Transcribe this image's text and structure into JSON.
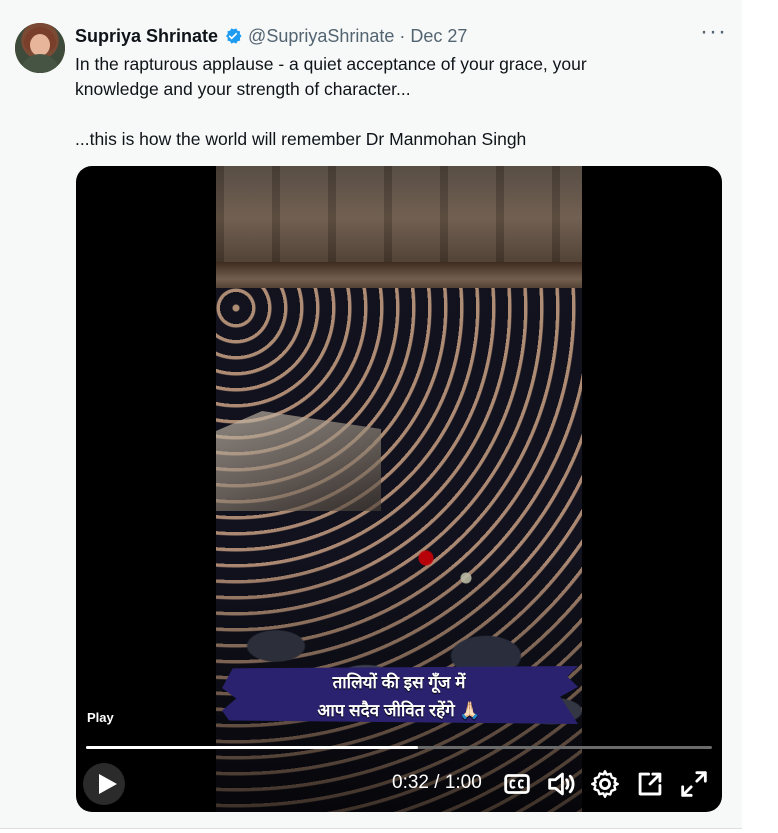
{
  "tweet": {
    "author_name": "Supriya Shrinate",
    "handle": "@SupriyaShrinate",
    "separator": "·",
    "date": "Dec 27",
    "more_label": "···",
    "text_line_1": "In the rapturous applause - a quiet acceptance of your grace, your",
    "text_line_2": "knowledge and your strength of character...",
    "text_line_3": "...this is how the world will remember Dr Manmohan Singh"
  },
  "video": {
    "caption_line_1": "तालियों की इस गूँज में",
    "caption_line_2": "आप सदैव जीवित रहेंगे 🙏🏻",
    "play_label": "Play",
    "time": "0:32 / 1:00",
    "progress_fraction": 0.53
  },
  "colors": {
    "verified": "#1d9bf0",
    "text": "#0f1419",
    "secondary": "#536471",
    "caption_bg": "#2a226f"
  },
  "icons": [
    "verified-badge-icon",
    "more-icon",
    "play-icon",
    "captions-icon",
    "volume-icon",
    "settings-icon",
    "picture-in-picture-icon",
    "fullscreen-icon"
  ]
}
